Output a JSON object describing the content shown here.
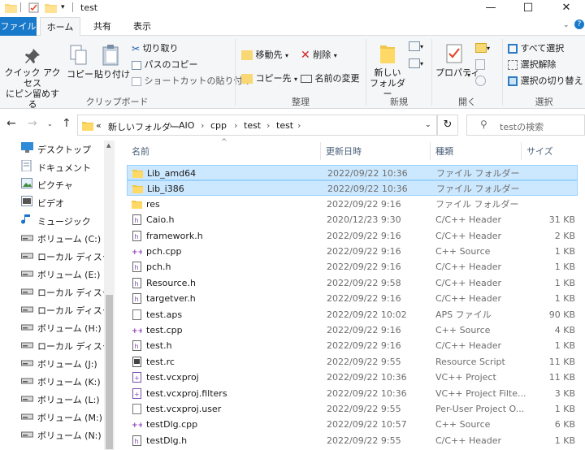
{
  "window": {
    "title": "test",
    "minimize": "—",
    "maximize": "☐",
    "close": "✕"
  },
  "tabs": [
    "ファイル",
    "ホーム",
    "共有",
    "表示"
  ],
  "ribbon": {
    "clipboard": {
      "pin": "クイック アクセス\nにピン留めする",
      "copy": "コピー",
      "paste": "貼り付け",
      "cut": "切り取り",
      "copy_path": "パスのコピー",
      "paste_shortcut": "ショートカットの貼り付け",
      "label": "クリップボード"
    },
    "organize": {
      "move_to": "移動先",
      "copy_to": "コピー先",
      "delete": "削除",
      "rename": "名前の変更",
      "label": "整理"
    },
    "new": {
      "new_folder": "新しい\nフォルダー",
      "label": "新規"
    },
    "open": {
      "properties": "プロパティ",
      "label": "開く"
    },
    "select": {
      "select_all": "すべて選択",
      "select_none": "選択解除",
      "invert": "選択の切り替え",
      "label": "選択"
    }
  },
  "address": {
    "breadcrumbs": [
      "«",
      "新しいフォルダー",
      "AIO",
      "cpp",
      "test",
      "test"
    ],
    "search_placeholder": "testの検索"
  },
  "nav": [
    {
      "label": "デスクトップ",
      "icon": "desktop-icon"
    },
    {
      "label": "ドキュメント",
      "icon": "document-icon"
    },
    {
      "label": "ピクチャ",
      "icon": "picture-icon"
    },
    {
      "label": "ビデオ",
      "icon": "video-icon"
    },
    {
      "label": "ミュージック",
      "icon": "music-icon"
    },
    {
      "label": "ボリューム (C:)",
      "icon": "drive-icon"
    },
    {
      "label": "ローカル ディスク (D",
      "icon": "drive-icon"
    },
    {
      "label": "ボリューム (E:)",
      "icon": "drive-icon"
    },
    {
      "label": "ローカル ディスク (F",
      "icon": "drive-icon"
    },
    {
      "label": "ローカル ディスク (G",
      "icon": "drive-icon"
    },
    {
      "label": "ボリューム (H:)",
      "icon": "drive-icon"
    },
    {
      "label": "ローカル ディスク (I:",
      "icon": "drive-icon"
    },
    {
      "label": "ボリューム (J:)",
      "icon": "drive-icon"
    },
    {
      "label": "ボリューム (K:)",
      "icon": "drive-icon"
    },
    {
      "label": "ボリューム (L:)",
      "icon": "drive-icon"
    },
    {
      "label": "ボリューム (M:)",
      "icon": "drive-icon"
    },
    {
      "label": "ボリューム (N:)",
      "icon": "drive-icon"
    }
  ],
  "columns": {
    "name": "名前",
    "date": "更新日時",
    "type": "種類",
    "size": "サイズ"
  },
  "files": [
    {
      "name": "Lib_amd64",
      "date": "2022/09/22 10:36",
      "type": "ファイル フォルダー",
      "size": "",
      "icon": "folder",
      "selected": true
    },
    {
      "name": "Lib_i386",
      "date": "2022/09/22 10:36",
      "type": "ファイル フォルダー",
      "size": "",
      "icon": "folder",
      "selected": true
    },
    {
      "name": "res",
      "date": "2022/09/22 9:16",
      "type": "ファイル フォルダー",
      "size": "",
      "icon": "folder",
      "selected": false
    },
    {
      "name": "Caio.h",
      "date": "2020/12/23 9:30",
      "type": "C/C++ Header",
      "size": "31 KB",
      "icon": "header",
      "selected": false
    },
    {
      "name": "framework.h",
      "date": "2022/09/22 9:16",
      "type": "C/C++ Header",
      "size": "2 KB",
      "icon": "header",
      "selected": false
    },
    {
      "name": "pch.cpp",
      "date": "2022/09/22 9:16",
      "type": "C++ Source",
      "size": "1 KB",
      "icon": "cpp",
      "selected": false
    },
    {
      "name": "pch.h",
      "date": "2022/09/22 9:16",
      "type": "C/C++ Header",
      "size": "1 KB",
      "icon": "header",
      "selected": false
    },
    {
      "name": "Resource.h",
      "date": "2022/09/22 9:58",
      "type": "C/C++ Header",
      "size": "1 KB",
      "icon": "header",
      "selected": false
    },
    {
      "name": "targetver.h",
      "date": "2022/09/22 9:16",
      "type": "C/C++ Header",
      "size": "1 KB",
      "icon": "header",
      "selected": false
    },
    {
      "name": "test.aps",
      "date": "2022/09/22 10:02",
      "type": "APS ファイル",
      "size": "90 KB",
      "icon": "blank",
      "selected": false
    },
    {
      "name": "test.cpp",
      "date": "2022/09/22 9:16",
      "type": "C++ Source",
      "size": "4 KB",
      "icon": "cpp",
      "selected": false
    },
    {
      "name": "test.h",
      "date": "2022/09/22 9:16",
      "type": "C/C++ Header",
      "size": "1 KB",
      "icon": "header",
      "selected": false
    },
    {
      "name": "test.rc",
      "date": "2022/09/22 9:55",
      "type": "Resource Script",
      "size": "11 KB",
      "icon": "rc",
      "selected": false
    },
    {
      "name": "test.vcxproj",
      "date": "2022/09/22 10:36",
      "type": "VC++ Project",
      "size": "11 KB",
      "icon": "proj",
      "selected": false
    },
    {
      "name": "test.vcxproj.filters",
      "date": "2022/09/22 10:36",
      "type": "VC++ Project Filte...",
      "size": "3 KB",
      "icon": "proj",
      "selected": false
    },
    {
      "name": "test.vcxproj.user",
      "date": "2022/09/22 9:55",
      "type": "Per-User Project O...",
      "size": "1 KB",
      "icon": "blank",
      "selected": false
    },
    {
      "name": "testDlg.cpp",
      "date": "2022/09/22 10:57",
      "type": "C++ Source",
      "size": "6 KB",
      "icon": "cpp",
      "selected": false
    },
    {
      "name": "testDlg.h",
      "date": "2022/09/22 9:55",
      "type": "C/C++ Header",
      "size": "1 KB",
      "icon": "header",
      "selected": false
    }
  ]
}
